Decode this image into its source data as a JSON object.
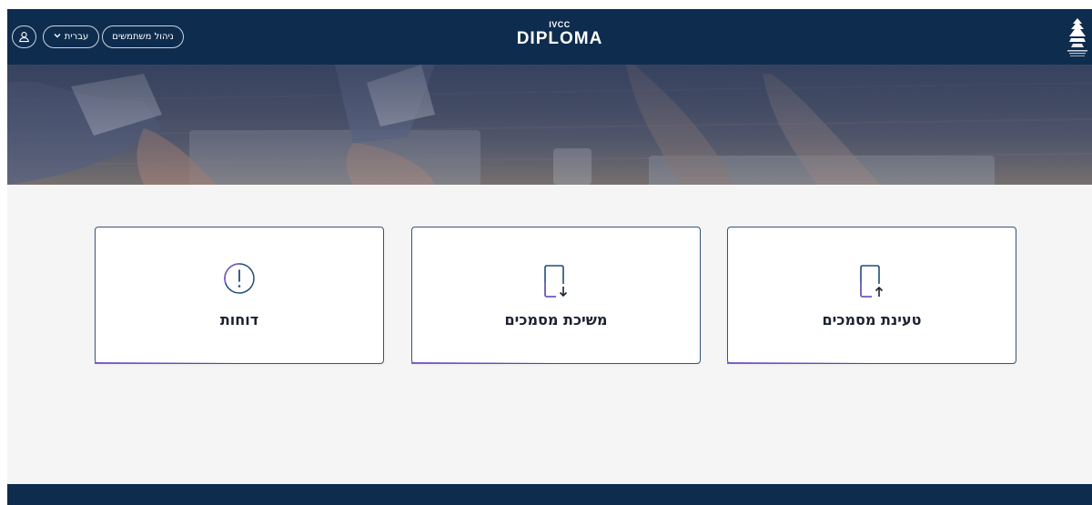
{
  "header": {
    "logo_top": "IVCC",
    "logo_main": "DIPLOMA",
    "language_label": "עברית",
    "manage_users_label": "ניהול משתמשים"
  },
  "icons": {
    "user": "user-icon",
    "chevron": "chevron-down-icon",
    "emblem": "emblem-logo",
    "reports": "exclamation-circle-icon",
    "retrieve": "document-download-icon",
    "upload": "document-upload-icon"
  },
  "cards": [
    {
      "id": "reports",
      "label": "דוחות"
    },
    {
      "id": "retrieve",
      "label": "משיכת מסמכים"
    },
    {
      "id": "upload",
      "label": "טעינת מסמכים"
    }
  ],
  "colors": {
    "header_bg": "#0e2c4e",
    "page_bg": "#f5f5f5",
    "card_border": "#33577c",
    "icon_accent": "#7a5bc6",
    "icon_stroke": "#1f4e79"
  }
}
